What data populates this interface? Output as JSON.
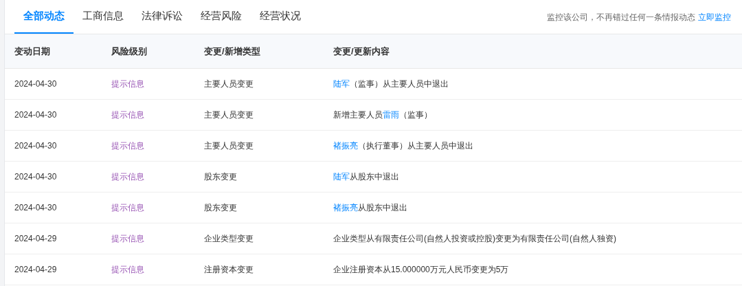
{
  "tabs": [
    {
      "label": "全部动态",
      "selected": true
    },
    {
      "label": "工商信息",
      "selected": false
    },
    {
      "label": "法律诉讼",
      "selected": false
    },
    {
      "label": "经营风险",
      "selected": false
    },
    {
      "label": "经营状况",
      "selected": false
    }
  ],
  "monitor": {
    "text": "监控该公司，不再错过任何一条情报动态",
    "link": "立即监控"
  },
  "table": {
    "columns": [
      "变动日期",
      "风险级别",
      "变更/新增类型",
      "变更/更新内容"
    ],
    "rows": [
      {
        "date": "2024-04-30",
        "risk": "提示信息",
        "type": "主要人员变更",
        "content": [
          {
            "text": "陆军",
            "link": true
          },
          {
            "text": "（监事）从主要人员中退出",
            "link": false
          }
        ]
      },
      {
        "date": "2024-04-30",
        "risk": "提示信息",
        "type": "主要人员变更",
        "content": [
          {
            "text": "新增主要人员",
            "link": false
          },
          {
            "text": "雷雨",
            "link": true
          },
          {
            "text": "（监事）",
            "link": false
          }
        ]
      },
      {
        "date": "2024-04-30",
        "risk": "提示信息",
        "type": "主要人员变更",
        "content": [
          {
            "text": "褚振亮",
            "link": true
          },
          {
            "text": "（执行董事）从主要人员中退出",
            "link": false
          }
        ]
      },
      {
        "date": "2024-04-30",
        "risk": "提示信息",
        "type": "股东变更",
        "content": [
          {
            "text": "陆军",
            "link": true
          },
          {
            "text": "从股东中退出",
            "link": false
          }
        ]
      },
      {
        "date": "2024-04-30",
        "risk": "提示信息",
        "type": "股东变更",
        "content": [
          {
            "text": "褚振亮",
            "link": true
          },
          {
            "text": "从股东中退出",
            "link": false
          }
        ]
      },
      {
        "date": "2024-04-29",
        "risk": "提示信息",
        "type": "企业类型变更",
        "content": [
          {
            "text": "企业类型从有限责任公司(自然人投资或控股)变更为有限责任公司(自然人独资)",
            "link": false
          }
        ]
      },
      {
        "date": "2024-04-29",
        "risk": "提示信息",
        "type": "注册资本变更",
        "content": [
          {
            "text": "企业注册资本从15.000000万元人民币变更为5万",
            "link": false
          }
        ]
      }
    ]
  }
}
